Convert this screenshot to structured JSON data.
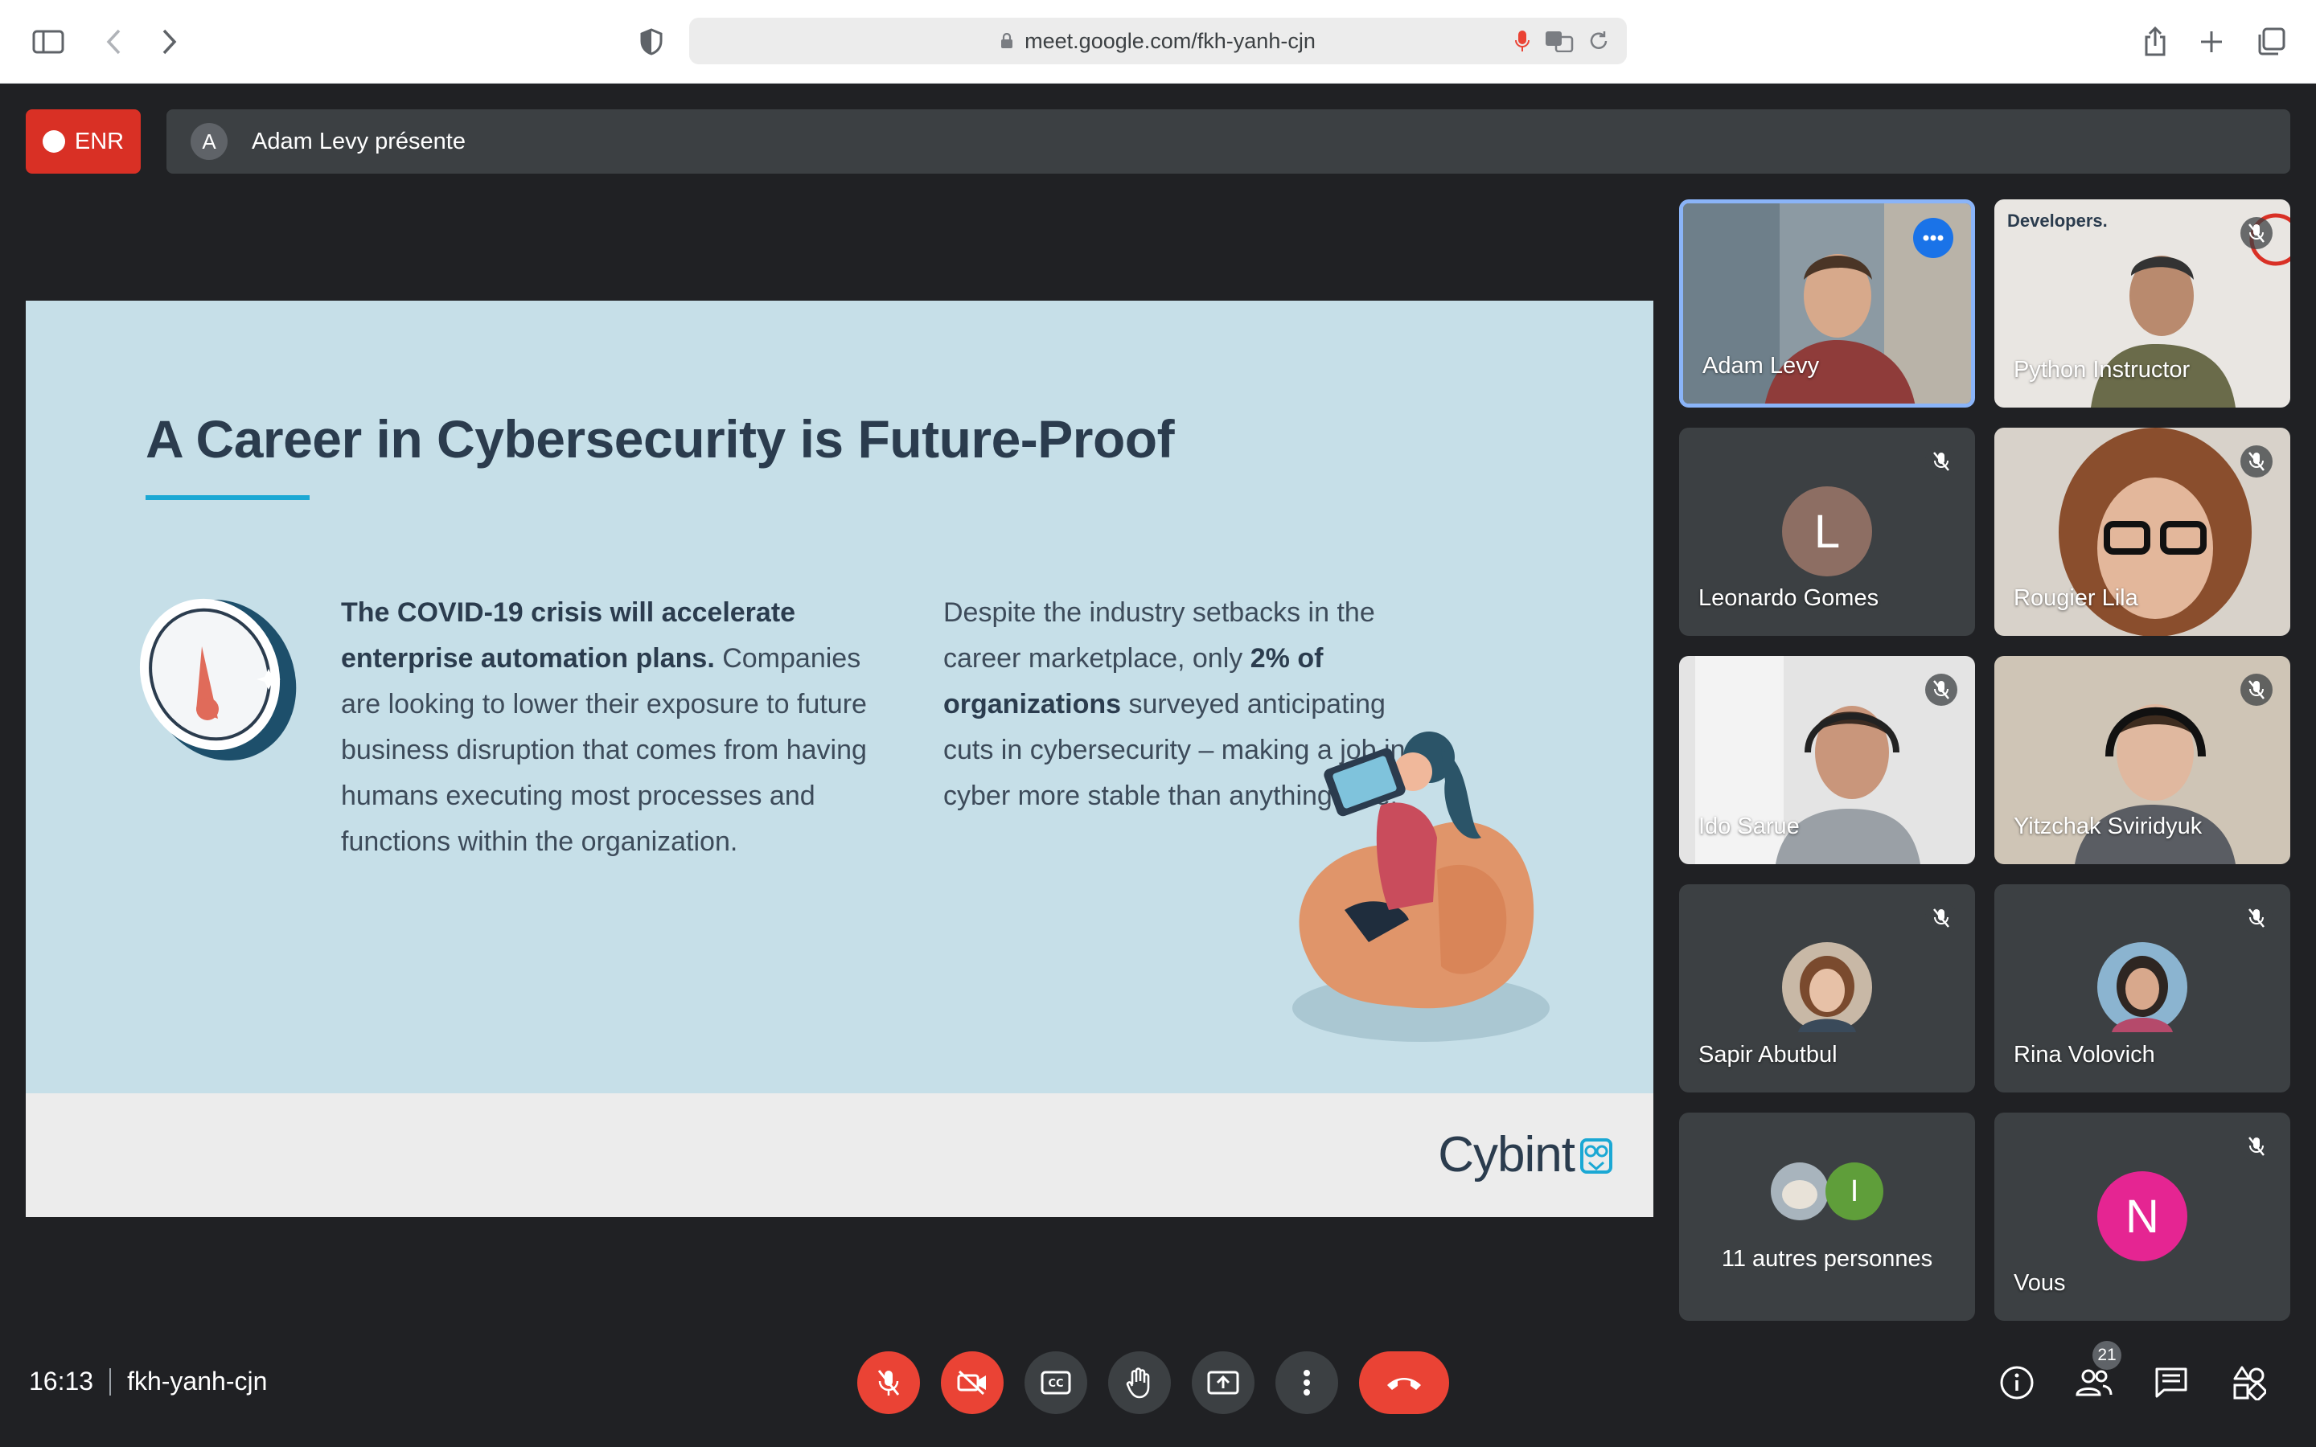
{
  "browser": {
    "url": "meet.google.com/fkh-yanh-cjn"
  },
  "meeting": {
    "recording_label": "ENR",
    "presenter_initial": "A",
    "presenting_text": "Adam Levy présente",
    "time": "16:13",
    "code": "fkh-yanh-cjn",
    "participant_count": "21"
  },
  "slide": {
    "title": "A Career in Cybersecurity is Future-Proof",
    "left_bold": "The COVID-19 crisis will accelerate enterprise automation plans.",
    "left_text": "Companies are looking to lower their exposure to future business disruption that comes from having humans executing most processes and functions within the organization.",
    "right_text_1": "Despite the industry setbacks in the career marketplace, only ",
    "right_bold": "2% of organizations",
    "right_text_2": " surveyed anticipating cuts in cybersecurity – making a job in cyber more stable than anything else.",
    "logo_text": "Cybint"
  },
  "participants": [
    {
      "name": "Adam Levy",
      "type": "video"
    },
    {
      "name": "Python Instructor",
      "type": "video",
      "overlay_text": "Developers."
    },
    {
      "name": "Leonardo Gomes",
      "type": "avatar",
      "initial": "L"
    },
    {
      "name": "Rougier Lila",
      "type": "video"
    },
    {
      "name": "Ido Sarue",
      "type": "video"
    },
    {
      "name": "Yitzchak Sviridyuk",
      "type": "video"
    },
    {
      "name": "Sapir Abutbul",
      "type": "photo"
    },
    {
      "name": "Rina Volovich",
      "type": "photo"
    },
    {
      "name": "11 autres personnes",
      "type": "group",
      "initial": "I"
    },
    {
      "name": "Vous",
      "type": "avatar",
      "initial": "N"
    }
  ],
  "colors": {
    "accent": "#1a73e8",
    "danger": "#ea4335",
    "slide_bg": "#c6dfe8",
    "title": "#2b3c4e"
  }
}
